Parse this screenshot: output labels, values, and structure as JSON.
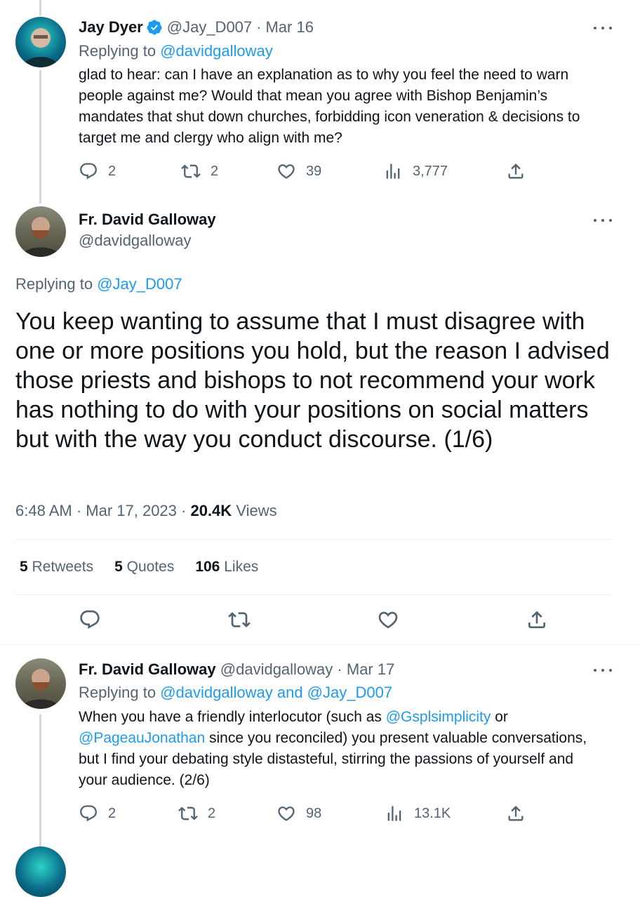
{
  "colors": {
    "accent": "#1d9bf0",
    "muted": "#536471",
    "text": "#0f1419"
  },
  "tweet1": {
    "name": "Jay Dyer",
    "handle": "@Jay_D007",
    "date": "Mar 16",
    "replying_label": "Replying to",
    "replying_to": "@davidgalloway",
    "text": "glad to hear: can I have an explanation as to why you feel the need to warn people against me? Would that mean you agree with Bishop Benjamin’s mandates that shut down churches, forbidding icon veneration & decisions to target me and clergy who align with me?",
    "replies": "2",
    "retweets": "2",
    "likes": "39",
    "views": "3,777"
  },
  "main": {
    "name": "Fr. David Galloway",
    "handle": "@davidgalloway",
    "replying_label": "Replying to",
    "replying_to": "@Jay_D007",
    "text": "You keep wanting to assume that I must disagree with one or more positions you hold, but the reason I advised those priests and bishops to not recommend your work has nothing to do with your positions on social matters but with the way you conduct discourse. (1/6)",
    "time": "6:48 AM · Mar 17, 2023 ·",
    "views_count": "20.4K",
    "views_label": "Views",
    "retweets_count": "5",
    "retweets_label": "Retweets",
    "quotes_count": "5",
    "quotes_label": "Quotes",
    "likes_count": "106",
    "likes_label": "Likes"
  },
  "tweet3": {
    "name": "Fr. David Galloway",
    "handle": "@davidgalloway",
    "date": "Mar 17",
    "replying_label": "Replying to",
    "replying_to": "@davidgalloway and @Jay_D007",
    "text_1": "When you have a friendly interlocutor (such as",
    "mention_1": "@Gsplsimplicity",
    "text_2": "or",
    "mention_2": "@PageauJonathan",
    "text_3": "since you reconciled) you present valuable conversations, but I find your debating style distasteful, stirring the passions of yourself and your audience. (2/6)",
    "replies": "2",
    "retweets": "2",
    "likes": "98",
    "views": "13.1K"
  },
  "icons": {
    "verified": "verified-badge-icon",
    "more": "more-icon",
    "reply": "reply-icon",
    "retweet": "retweet-icon",
    "like": "like-icon",
    "views": "views-icon",
    "share": "share-icon"
  }
}
